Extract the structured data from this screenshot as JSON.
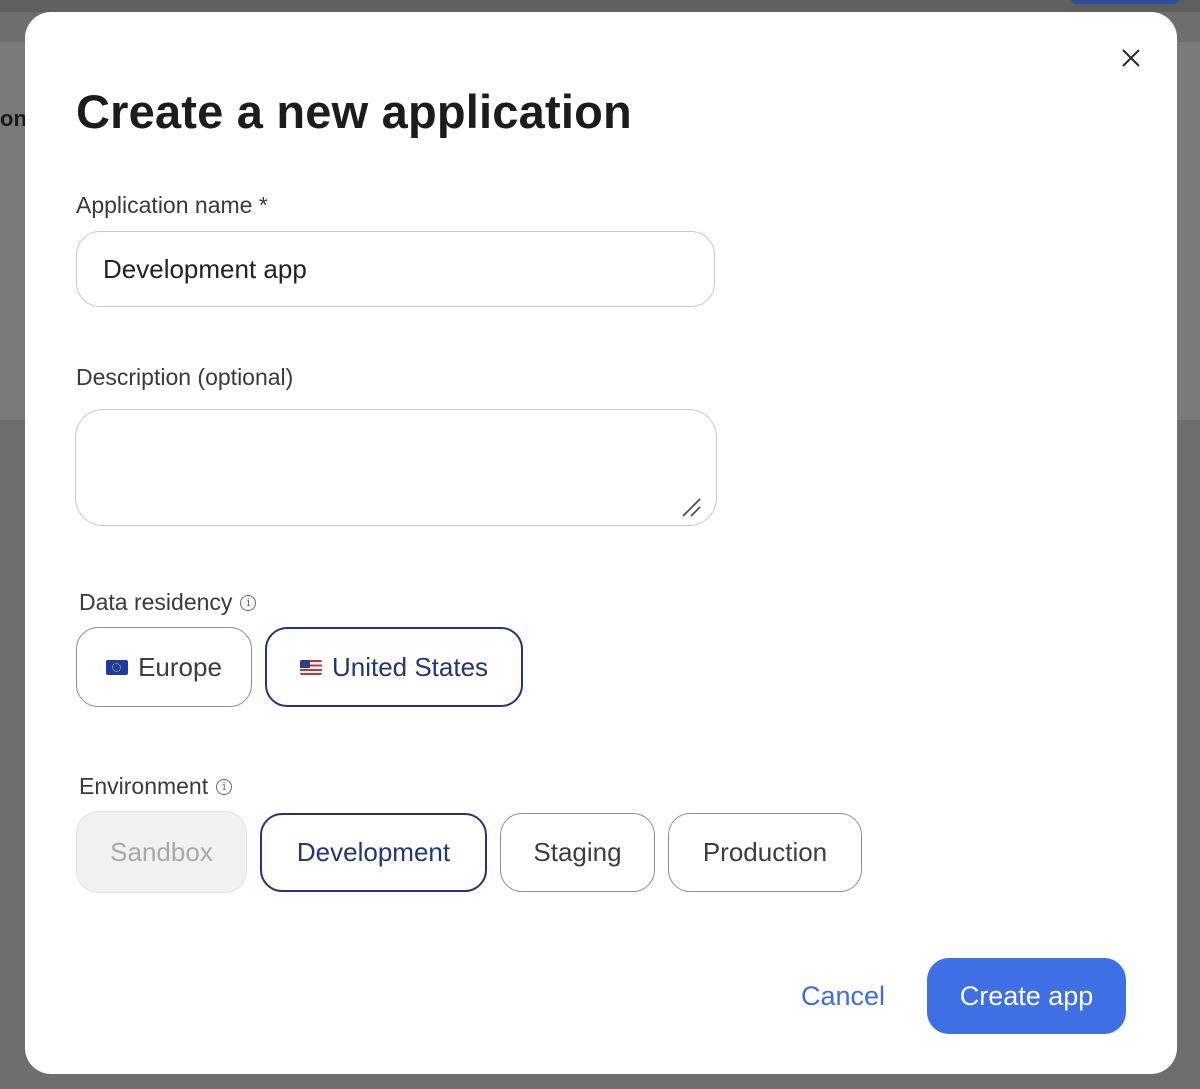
{
  "background": {
    "partial_text": "on l"
  },
  "modal": {
    "title": "Create a new application",
    "close_icon": "close-icon",
    "fields": {
      "app_name": {
        "label": "Application name *",
        "value": "Development app"
      },
      "description": {
        "label": "Description (optional)",
        "value": "",
        "placeholder": ""
      }
    },
    "data_residency": {
      "label": "Data residency",
      "info_icon": "info-icon",
      "options": [
        {
          "label": "Europe",
          "flag": "eu-flag-icon",
          "state": "default"
        },
        {
          "label": "United States",
          "flag": "us-flag-icon",
          "state": "selected"
        }
      ]
    },
    "environment": {
      "label": "Environment",
      "info_icon": "info-icon",
      "options": [
        {
          "label": "Sandbox",
          "state": "disabled"
        },
        {
          "label": "Development",
          "state": "selected"
        },
        {
          "label": "Staging",
          "state": "default"
        },
        {
          "label": "Production",
          "state": "default"
        }
      ]
    },
    "actions": {
      "cancel": "Cancel",
      "create": "Create app"
    }
  },
  "colors": {
    "primary": "#3f6fe4",
    "selected_border": "#22357a",
    "overlay": "#6e6e6e"
  }
}
